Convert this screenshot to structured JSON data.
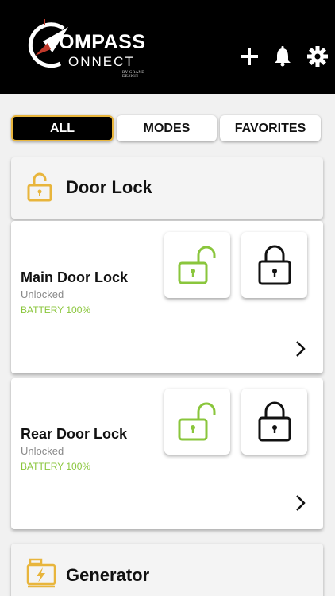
{
  "app": {
    "logo_main": "OMPASS",
    "logo_sub": "ONNECT",
    "logo_tagline": "BY GRAND DESIGN"
  },
  "header": {
    "icons": [
      "plus-icon",
      "bell-icon",
      "gear-icon"
    ]
  },
  "tabs": [
    {
      "label": "ALL",
      "active": true
    },
    {
      "label": "MODES",
      "active": false
    },
    {
      "label": "FAVORITES",
      "active": false
    }
  ],
  "sections": [
    {
      "title": "Door Lock",
      "icon": "padlock-icon",
      "devices": [
        {
          "name": "Main Door Lock",
          "status": "Unlocked",
          "battery": "BATTERY 100%"
        },
        {
          "name": "Rear Door Lock",
          "status": "Unlocked",
          "battery": "BATTERY 100%"
        }
      ]
    },
    {
      "title": "Generator",
      "icon": "generator-icon"
    }
  ],
  "colors": {
    "accent_yellow": "#e8b53c",
    "battery_green": "#8ac63c",
    "header_bg": "#000000"
  }
}
